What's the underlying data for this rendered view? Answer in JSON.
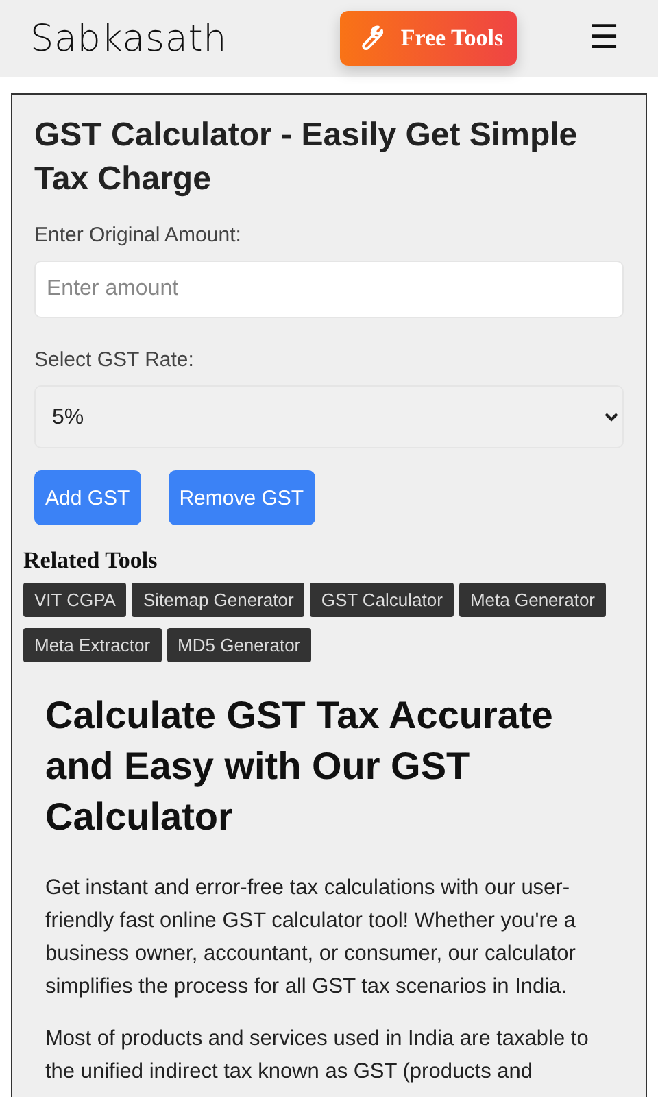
{
  "header": {
    "logo": "Sabkasath",
    "cta": "Free Tools",
    "menu": "☰"
  },
  "calculator": {
    "title": "GST Calculator - Easily Get Simple Tax Charge",
    "amount": {
      "label": "Enter Original Amount:",
      "placeholder": "Enter amount"
    },
    "rate": {
      "label": "Select GST Rate:",
      "value": "5%"
    },
    "buttons": [
      "Add GST",
      "Remove GST"
    ]
  },
  "related": {
    "title": "Related Tools",
    "tools": [
      "VIT CGPA",
      "Sitemap Generator",
      "GST Calculator",
      "Meta Generator",
      "Meta Extractor",
      "MD5 Generator"
    ]
  },
  "article": {
    "heading": "Calculate GST Tax Accurate and Easy with Our GST Calculator",
    "paragraphs": [
      "Get instant and error-free tax calculations with our user-friendly fast online GST calculator tool! Whether you're a business owner, accountant, or consumer, our calculator simplifies the process for all GST tax scenarios in India.",
      "Most of products and services used in India are taxable to the unified indirect tax known as GST (products and"
    ]
  }
}
